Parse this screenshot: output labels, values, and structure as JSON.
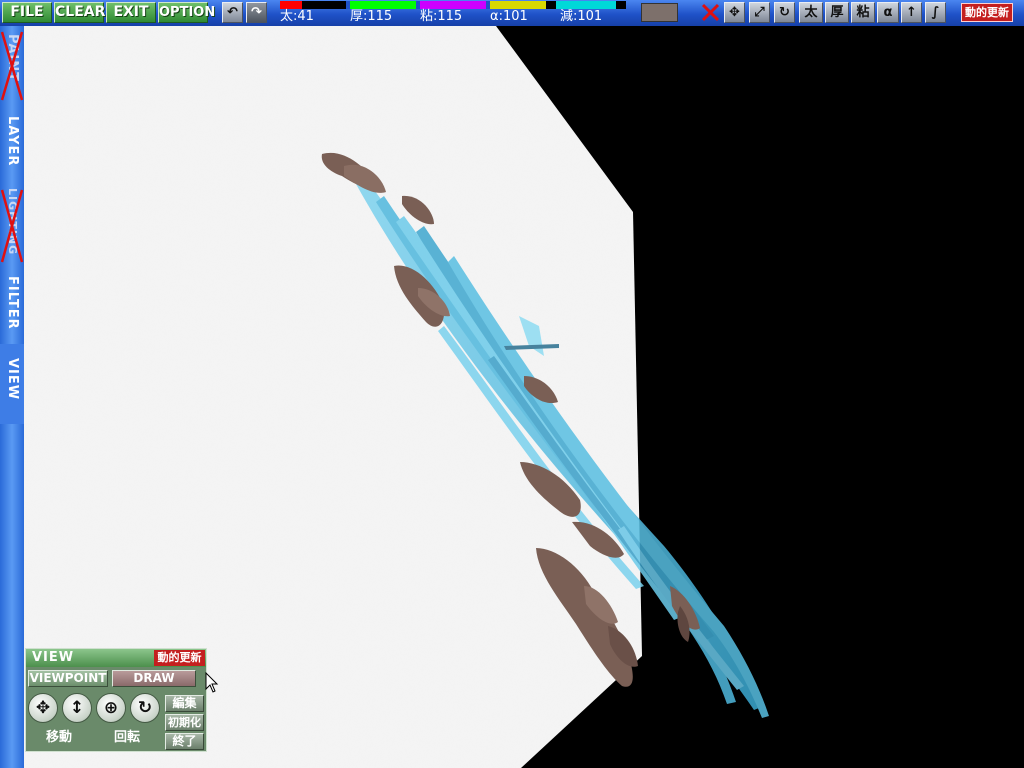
{
  "menu": {
    "file": "FILE",
    "clear": "CLEAR",
    "exit": "EXIT",
    "option": "OPTION"
  },
  "toolbar": {
    "undo_icon": "undo-icon",
    "redo_icon": "redo-icon",
    "params": [
      {
        "key": "size",
        "text": "太:41"
      },
      {
        "key": "thickness",
        "text": "厚:115"
      },
      {
        "key": "viscosity",
        "text": "粘:115"
      },
      {
        "key": "alpha",
        "text": "α:101"
      },
      {
        "key": "decay",
        "text": "減:101"
      }
    ],
    "swatches": [
      "#ff0000",
      "#000000",
      "#00ff00",
      "#ff00ff",
      "#ffff00",
      "#00ffff"
    ],
    "current_color": "#7d706b",
    "tool_icons": [
      "close-icon",
      "move-icon",
      "scale-icon",
      "rotate-icon",
      "size-icon",
      "thickness-icon",
      "viscosity-icon",
      "alpha-icon",
      "up-arrow-icon",
      "smudge-icon"
    ],
    "tool_glyphs": {
      "size": "太",
      "thickness": "厚",
      "viscosity": "粘",
      "alpha": "α"
    },
    "auto_update": "動的更新"
  },
  "sidebar": {
    "tabs": [
      {
        "label": "PAINT",
        "disabled": true
      },
      {
        "label": "LAYER",
        "disabled": false
      },
      {
        "label": "LIGHTING",
        "disabled": true
      },
      {
        "label": "FILTER",
        "disabled": false
      },
      {
        "label": "VIEW",
        "disabled": false,
        "active": true
      }
    ]
  },
  "view_panel": {
    "title": "VIEW",
    "auto_update": "動的更新",
    "tab_viewpoint": "VIEWPOINT",
    "tab_draw": "DRAW",
    "caption_move": "移動",
    "caption_rotate": "回転",
    "btn_edit": "編集",
    "btn_reset": "初期化",
    "btn_end": "終了",
    "tool_icons": [
      "pan-icon",
      "vertical-move-icon",
      "orbit-icon",
      "rotate-icon"
    ]
  },
  "colors": {
    "canvas_surface": "#f4f4f4",
    "paint_blue": "#5fc3e4",
    "paint_brown": "#7a5f55"
  }
}
